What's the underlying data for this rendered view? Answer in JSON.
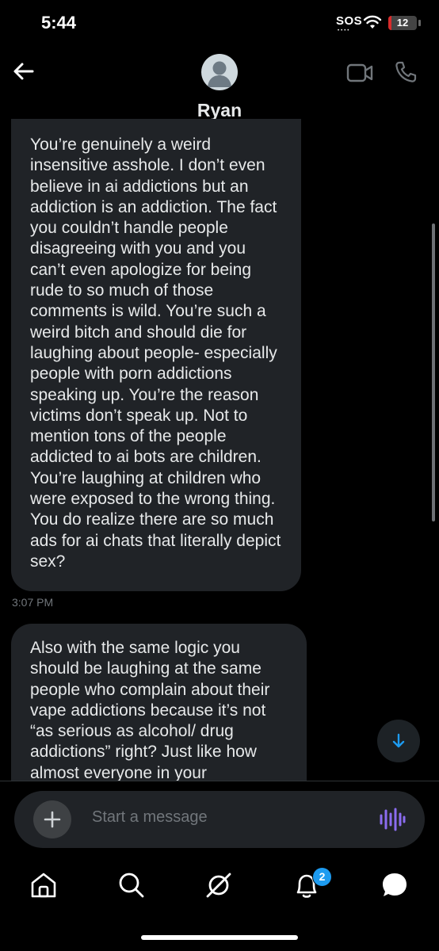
{
  "status_bar": {
    "time": "5:44",
    "sos_label": "SOS",
    "battery_level": "12",
    "battery_fraction": 0.12
  },
  "header": {
    "contact_name": "Ryan",
    "back_icon": "arrow-left-icon",
    "video_icon": "video-camera-icon",
    "call_icon": "phone-icon"
  },
  "messages": [
    {
      "text": "You’re genuinely a weird insensitive asshole. I don’t even believe in ai addictions but an addiction is an addiction. The fact you couldn’t handle people disagreeing with you and you can’t even apologize for being rude to so much of those comments is wild. You’re such a weird bitch and should die for laughing about people- especially people with porn addictions speaking up. You’re the reason victims don’t speak up. Not to mention tons of the people addicted to ai bots are children. You’re laughing at children who were exposed to the wrong thing. You do realize there are so much ads for ai chats that literally depict sex?",
      "time": "3:07 PM"
    },
    {
      "text": "Also with the same logic you should be laughing at the same people who complain about their vape addictions because it’s not “as serious as alcohol/ drug addictions” right? Just like how almost everyone in your"
    }
  ],
  "composer": {
    "placeholder": "Start a message",
    "add_icon": "plus-icon",
    "voice_icon": "voice-waveform-icon"
  },
  "nav": {
    "items": [
      "home-icon",
      "search-icon",
      "grok-icon",
      "notifications-icon",
      "messages-icon"
    ],
    "notification_count": "2"
  },
  "colors": {
    "background": "#000000",
    "bubble": "#202327",
    "accent": "#1d9bf0",
    "voice": "#8b6cf0",
    "muted": "#71767b"
  }
}
